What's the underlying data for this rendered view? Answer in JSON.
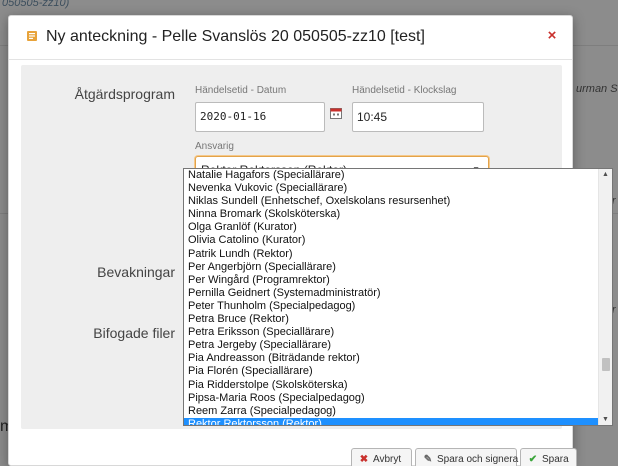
{
  "background": {
    "top_text": "050505-zz10)",
    "right_text_1": "urman Sv",
    "right_text_2": "r",
    "right_text_3": "r",
    "left_fragment": "m"
  },
  "dialog": {
    "title": "Ny anteckning - Pelle Svanslös 20 050505-zz10 [test]",
    "close_symbol": "×",
    "labels": {
      "atgardsprogram": "Åtgärdsprogram",
      "bevakningar": "Bevakningar",
      "bifogade_filer": "Bifogade filer"
    },
    "datum": {
      "caption": "Händelsetid - Datum",
      "value": "2020-01-16"
    },
    "klockslag": {
      "caption": "Händelsetid - Klockslag",
      "value": "10:45"
    },
    "ansvarig": {
      "caption": "Ansvarig",
      "selected": "Rektor Rektorsson (Rektor)"
    },
    "dropdown_options": [
      "Natalie Hagafors (Speciallärare)",
      "Nevenka Vukovic (Speciallärare)",
      "Niklas Sundell (Enhetschef, Oxelskolans resursenhet)",
      "Ninna Bromark (Skolsköterska)",
      "Olga Granlöf (Kurator)",
      "Olivia Catolino (Kurator)",
      "Patrik Lundh (Rektor)",
      "Per Angerbjörn (Speciallärare)",
      "Per Wingård (Programrektor)",
      "Pernilla Geidnert (Systemadministratör)",
      "Peter Thunholm (Specialpedagog)",
      "Petra Bruce (Rektor)",
      "Petra Eriksson (Speciallärare)",
      "Petra Jergeby (Speciallärare)",
      "Pia Andreasson (Biträdande rektor)",
      "Pia Florén (Speciallärare)",
      "Pia Ridderstolpe (Skolsköterska)",
      "Pipsa-Maria Roos (Specialpedagog)",
      "Reem Zarra (Specialpedagog)",
      "Rektor Rektorsson (Rektor)"
    ],
    "buttons": {
      "avbryt": "Avbryt",
      "spara_signera": "Spara och signera",
      "spara": "Spara"
    },
    "colors": {
      "close": "#c9302c",
      "select_focus": "#e3a34a",
      "selected_option": "#1e90ff",
      "save_check": "#3aa53a"
    }
  }
}
